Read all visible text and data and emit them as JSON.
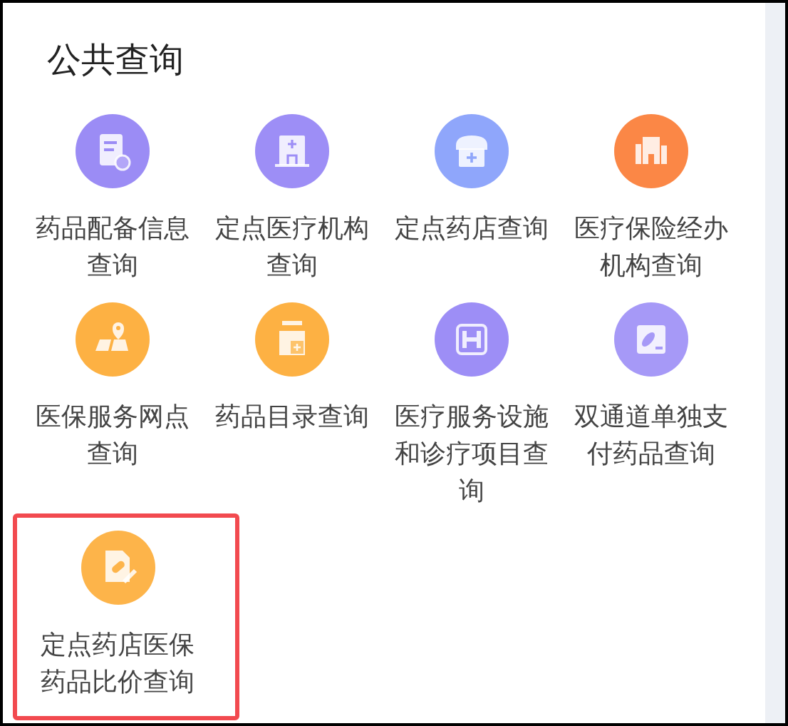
{
  "section": {
    "title": "公共查询"
  },
  "items": [
    {
      "label": "药品配备信息查询",
      "color": "#9b8cf5",
      "selected": false
    },
    {
      "label": "定点医疗机构查询",
      "color": "#9d8ef6",
      "selected": false
    },
    {
      "label": "定点药店查询",
      "color": "#8fa6fb",
      "selected": false
    },
    {
      "label": "医疗保险经办机构查询",
      "color": "#fb8746",
      "selected": false
    },
    {
      "label": "医保服务网点查询",
      "color": "#fdb143",
      "selected": false
    },
    {
      "label": "药品目录查询",
      "color": "#fdb143",
      "selected": false
    },
    {
      "label": "医疗服务设施和诊疗项目查询",
      "color": "#9d8ef6",
      "selected": false
    },
    {
      "label": "双通道单独支付药品查询",
      "color": "#a699f7",
      "selected": false
    },
    {
      "label": "定点药店医保药品比价查询",
      "color": "#fdb44a",
      "selected": true
    }
  ]
}
